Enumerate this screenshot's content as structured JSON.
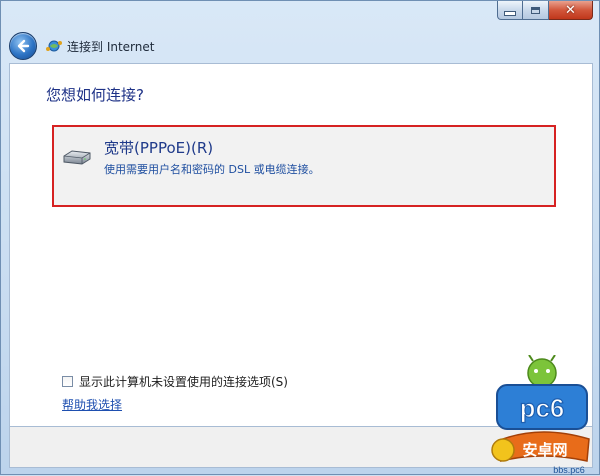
{
  "window": {
    "title": "连接到 Internet",
    "caption_buttons": [
      "minimize-icon",
      "maximize-icon",
      "close-icon"
    ],
    "close_glyph": "✕"
  },
  "header": {
    "back_icon": "back-arrow-icon",
    "forward_icon": "forward-arrow-icon",
    "title_icon": "network-globe-icon"
  },
  "main": {
    "question": "您想如何连接?",
    "options": [
      {
        "icon": "broadband-modem-icon",
        "title": "宽带(PPPoE)(R)",
        "description": "使用需要用户名和密码的 DSL 或电缆连接。",
        "highlight_color": "#d62222"
      }
    ],
    "checkbox": {
      "label": "显示此计算机未设置使用的连接选项(S)",
      "checked": false
    },
    "help_link": "帮助我选择"
  },
  "watermark": {
    "brand": "pc6",
    "sub": "安卓网",
    "site": "bbs.pc6"
  },
  "colors": {
    "accent": "#1e3287",
    "link": "#1e4fb0",
    "highlight": "#d62222"
  }
}
